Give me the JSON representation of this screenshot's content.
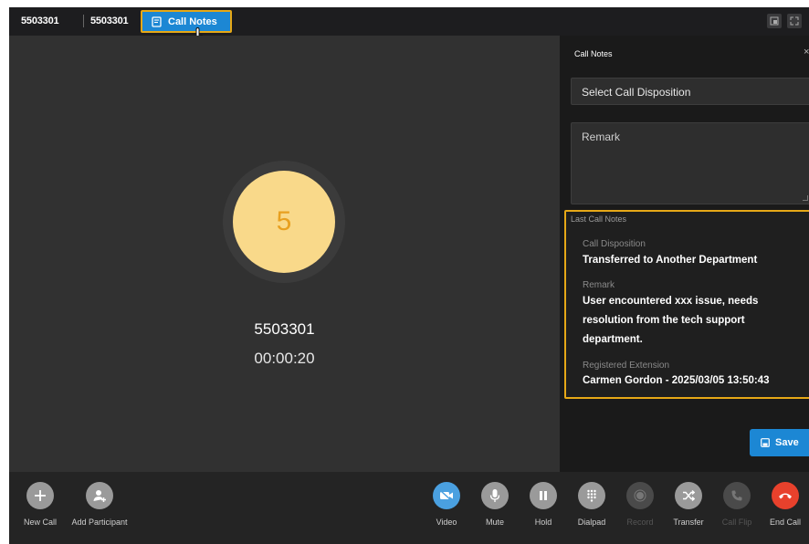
{
  "topbar": {
    "caller_id": "5503301",
    "extension": "5503301",
    "call_notes_label": "Call Notes"
  },
  "call": {
    "avatar_initial": "5",
    "number": "5503301",
    "timer": "00:00:20"
  },
  "panel": {
    "title": "Call Notes",
    "close_glyph": "×",
    "disposition_placeholder": "Select Call Disposition",
    "remark_placeholder": "Remark",
    "last_notes": {
      "title": "Last Call Notes",
      "disposition_label": "Call Disposition",
      "disposition_value": "Transferred to Another Department",
      "remark_label": "Remark",
      "remark_value": "User encountered xxx issue, needs resolution from the tech support department.",
      "extension_label": "Registered Extension",
      "extension_value": "Carmen Gordon - 2025/03/05 13:50:43"
    },
    "save_label": "Save"
  },
  "toolbar": {
    "new_call": "New Call",
    "add_participant": "Add Participant",
    "video": "Video",
    "mute": "Mute",
    "hold": "Hold",
    "dialpad": "Dialpad",
    "record": "Record",
    "transfer": "Transfer",
    "call_flip": "Call Flip",
    "end_call": "End Call"
  },
  "colors": {
    "accent_blue": "#1c87d4",
    "highlight_orange": "#e6a817",
    "avatar_fill": "#f9d98a",
    "end_call_red": "#e8412c"
  },
  "icons": {
    "call_notes": "notes-icon",
    "save": "floppy-disk-icon",
    "new_call": "plus-icon",
    "add_participant": "add-person-icon",
    "video": "video-camera-icon",
    "mute": "microphone-icon",
    "hold": "pause-icon",
    "dialpad": "keypad-icon",
    "record": "record-icon",
    "transfer": "shuffle-icon",
    "call_flip": "phone-flip-icon",
    "end_call": "phone-hangup-icon"
  }
}
